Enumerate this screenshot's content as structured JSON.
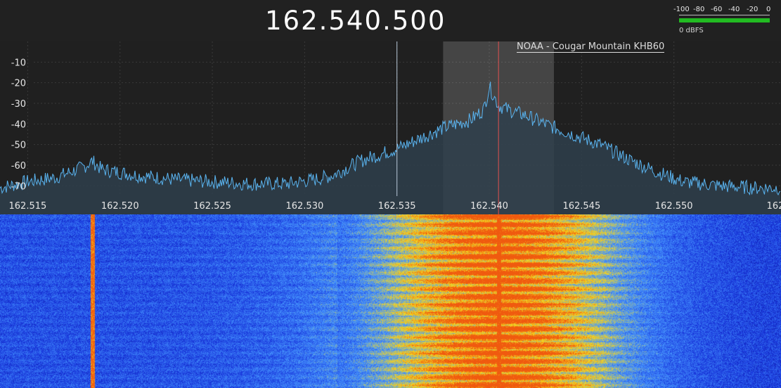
{
  "frequency_display": "162.540.500",
  "level_meter": {
    "ticks": [
      "-100",
      "-80",
      "-60",
      "-40",
      "-20",
      "0"
    ],
    "label": "0 dBFS",
    "bar_color": "#22bb22"
  },
  "bookmark": {
    "label": "NOAA - Cougar Mountain KHB60",
    "marker_color": "#e05050"
  },
  "chart_data": {
    "type": "line",
    "x_unit": "MHz",
    "x_ticks": [
      162.515,
      162.52,
      162.525,
      162.53,
      162.535,
      162.54,
      162.545,
      162.55
    ],
    "x_tick_labels": [
      "162.515",
      "162.520",
      "162.525",
      "162.530",
      "162.535",
      "162.540",
      "162.545",
      "162.550",
      "162"
    ],
    "y_ticks": [
      -10,
      -20,
      -30,
      -40,
      -50,
      -60,
      -70
    ],
    "y_tick_labels": [
      "-10",
      "-20",
      "-30",
      "-40",
      "-50",
      "-60",
      "-70"
    ],
    "xlim": [
      162.5135,
      162.5558
    ],
    "ylim": [
      -75,
      0
    ],
    "filter_band": [
      162.5375,
      162.5435
    ],
    "demod_freq": 162.5405,
    "cursor_freq": 162.535,
    "trace_color": "#5ab4f0",
    "fill_color": "#2f3f4c",
    "shape_points": [
      [
        162.5135,
        -71
      ],
      [
        162.515,
        -68
      ],
      [
        162.5165,
        -66
      ],
      [
        162.518,
        -61
      ],
      [
        162.5185,
        -58
      ],
      [
        162.519,
        -62
      ],
      [
        162.521,
        -65
      ],
      [
        162.523,
        -67
      ],
      [
        162.525,
        -68
      ],
      [
        162.527,
        -69
      ],
      [
        162.529,
        -69
      ],
      [
        162.5305,
        -67
      ],
      [
        162.5315,
        -65
      ],
      [
        162.533,
        -58
      ],
      [
        162.535,
        -52
      ],
      [
        162.5365,
        -46
      ],
      [
        162.5375,
        -42
      ],
      [
        162.539,
        -38
      ],
      [
        162.5397,
        -33
      ],
      [
        162.54,
        -22
      ],
      [
        162.5405,
        -31
      ],
      [
        162.541,
        -33
      ],
      [
        162.542,
        -36
      ],
      [
        162.543,
        -40
      ],
      [
        162.5445,
        -45
      ],
      [
        162.546,
        -50
      ],
      [
        162.5475,
        -57
      ],
      [
        162.549,
        -63
      ],
      [
        162.5505,
        -68
      ],
      [
        162.5525,
        -70
      ],
      [
        162.5545,
        -71
      ],
      [
        162.5558,
        -71
      ]
    ]
  },
  "waterfall": {
    "colors": [
      "#04037a",
      "#1d3ee0",
      "#3e8fff",
      "#f4d020",
      "#f06010"
    ]
  }
}
